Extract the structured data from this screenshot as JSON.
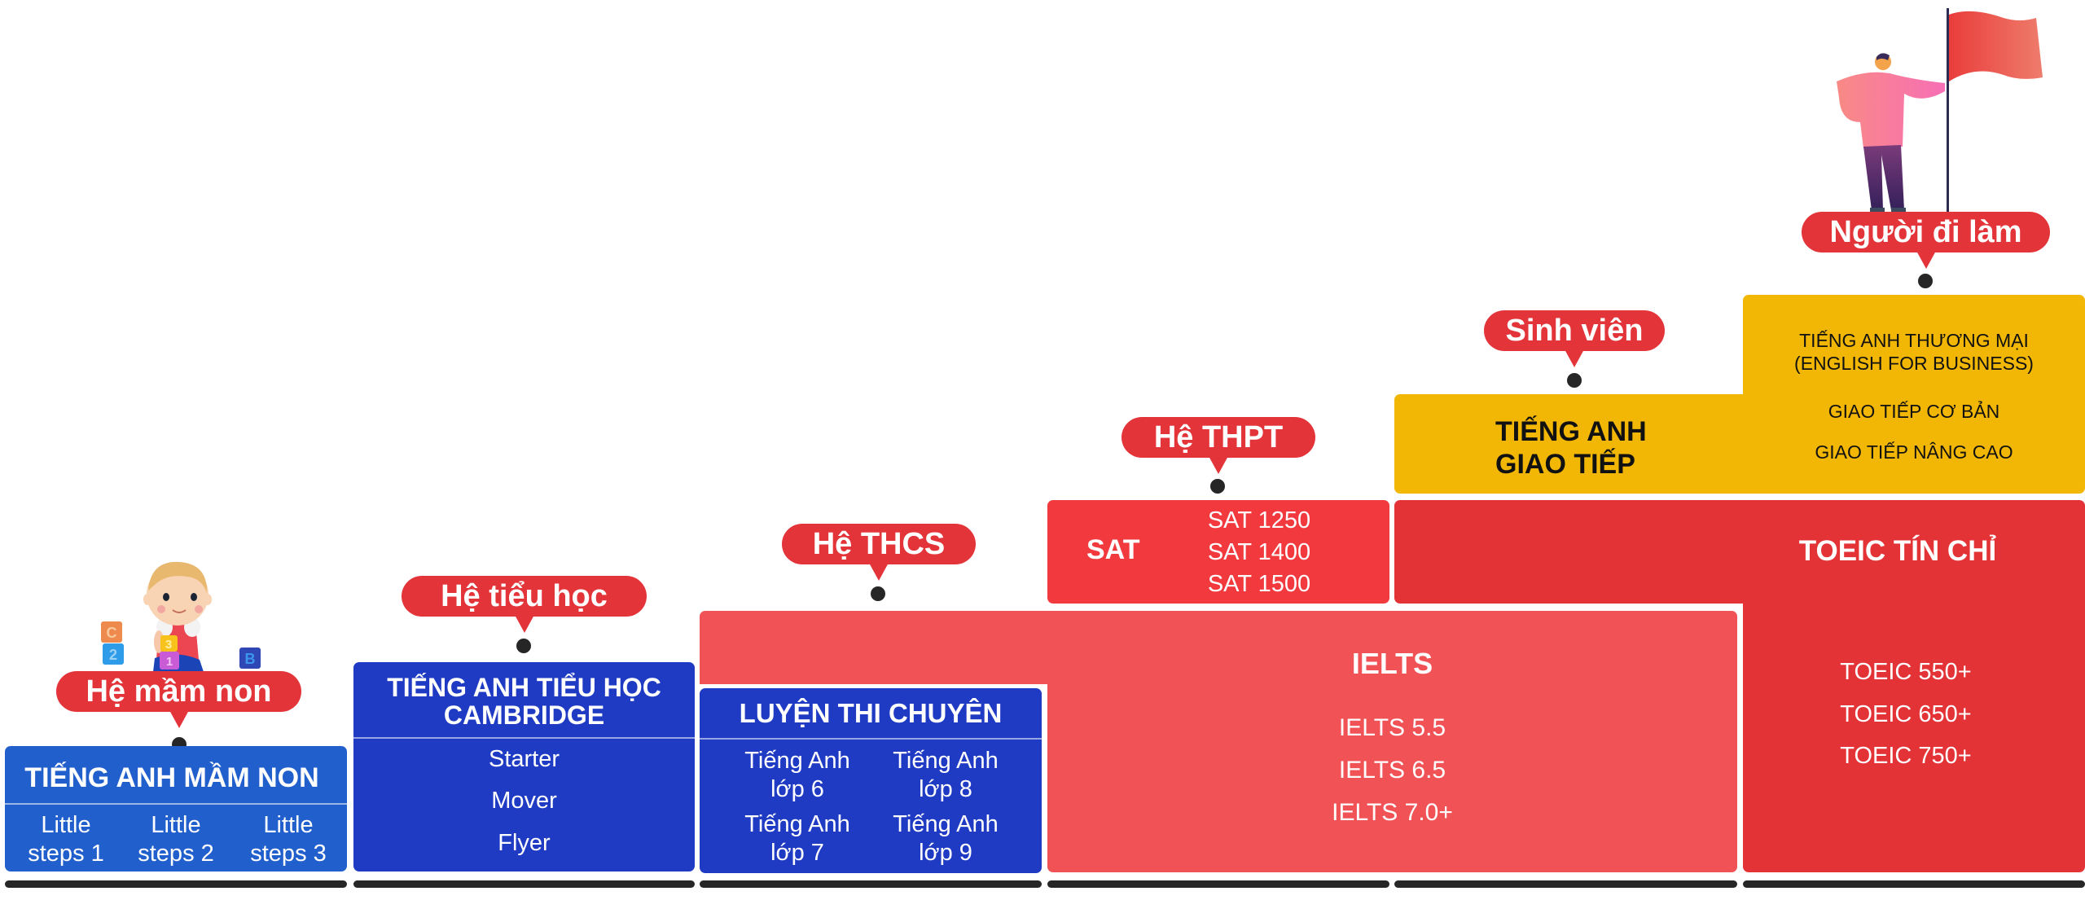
{
  "levels": [
    {
      "label": "Hệ mầm non",
      "program": {
        "title": "TIẾNG ANH MẦM NON",
        "courses": [
          "Little steps 1",
          "Little steps 2",
          "Little steps 3"
        ],
        "courses_lines": [
          [
            "Little",
            "steps 1"
          ],
          [
            "Little",
            "steps 2"
          ],
          [
            "Little",
            "steps 3"
          ]
        ]
      }
    },
    {
      "label": "Hệ tiểu học",
      "program": {
        "title_lines": [
          "TIẾNG ANH TIỂU HỌC",
          "CAMBRIDGE"
        ],
        "courses": [
          "Starter",
          "Mover",
          "Flyer"
        ]
      }
    },
    {
      "label": "Hệ THCS",
      "program": {
        "title": "LUYỆN THI CHUYÊN",
        "courses_lines": [
          [
            "Tiếng Anh",
            "lớp 6"
          ],
          [
            "Tiếng Anh",
            "lớp 8"
          ],
          [
            "Tiếng Anh",
            "lớp 7"
          ],
          [
            "Tiếng Anh",
            "lớp 9"
          ]
        ]
      },
      "shared_program": {
        "title": "IELTS",
        "courses": [
          "IELTS 5.5",
          "IELTS 6.5",
          "IELTS 7.0+"
        ]
      }
    },
    {
      "label": "Hệ THPT",
      "program": {
        "title": "SAT",
        "courses": [
          "SAT 1250",
          "SAT 1400",
          "SAT 1500"
        ]
      }
    },
    {
      "label": "Sinh viên",
      "program": {
        "title_lines": [
          "TIẾNG ANH",
          "GIAO TIẾP"
        ],
        "courses": [
          "GIAO TIẾP CƠ BẢN",
          "GIAO TIẾP NÂNG CAO"
        ]
      },
      "shared_program": {
        "title": "TOEIC TÍN CHỈ",
        "courses": [
          "TOEIC 550+",
          "TOEIC 650+",
          "TOEIC 750+"
        ]
      }
    },
    {
      "label": "Người đi làm",
      "program": {
        "title_lines": [
          "TIẾNG ANH THƯƠNG MẠI",
          "(ENGLISH FOR BUSINESS)"
        ]
      }
    }
  ],
  "colors": {
    "label_pill": "#E3343A",
    "kindergarten_blue": "#2160CC",
    "primary_blue": "#1F3BC4",
    "ielts_red": "#F05255",
    "sat_red": "#F23A3E",
    "toeic_red": "#E33337",
    "communication_yellow": "#F2B705",
    "timeline_bar": "#262626"
  },
  "illustrations": {
    "child": "baby-with-blocks",
    "child_blocks": [
      "C",
      "2",
      "3",
      "1",
      "B"
    ],
    "adult": "man-holding-flag"
  }
}
